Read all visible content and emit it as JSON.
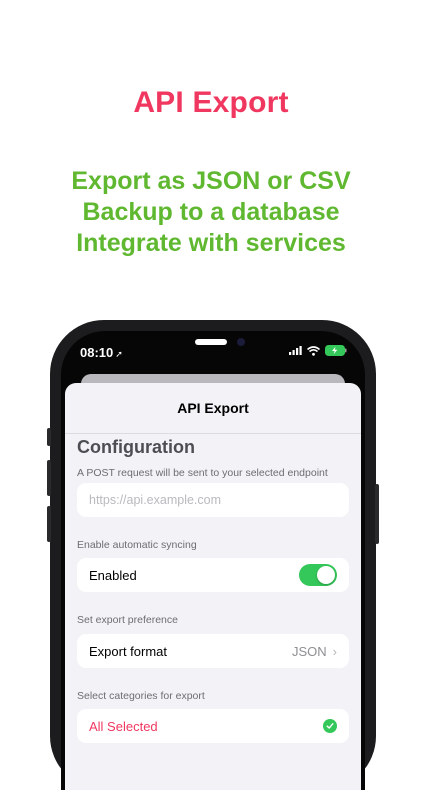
{
  "promo": {
    "title": "API Export",
    "lines": [
      "Export as JSON or CSV",
      "Backup to a database",
      "Integrate with services"
    ]
  },
  "status_bar": {
    "time": "08:10"
  },
  "sheet": {
    "nav_title": "API Export",
    "section_title": "Configuration",
    "endpoint_caption": "A POST request will be sent to your selected endpoint",
    "endpoint_placeholder": "https://api.example.com",
    "sync_caption": "Enable automatic syncing",
    "sync_label": "Enabled",
    "sync_on": true,
    "preference_caption": "Set export preference",
    "format_label": "Export format",
    "format_value": "JSON",
    "categories_caption": "Select categories for export",
    "categories_label": "All Selected"
  },
  "colors": {
    "title": "#f0375f",
    "promo_lines": "#5fb830",
    "toggle_on": "#34c759",
    "destructive": "#f0375f"
  },
  "icons": [
    "location-arrow-icon",
    "signal-icon",
    "wifi-icon",
    "battery-charging-icon",
    "chevron-right-icon",
    "checkmark-icon"
  ]
}
